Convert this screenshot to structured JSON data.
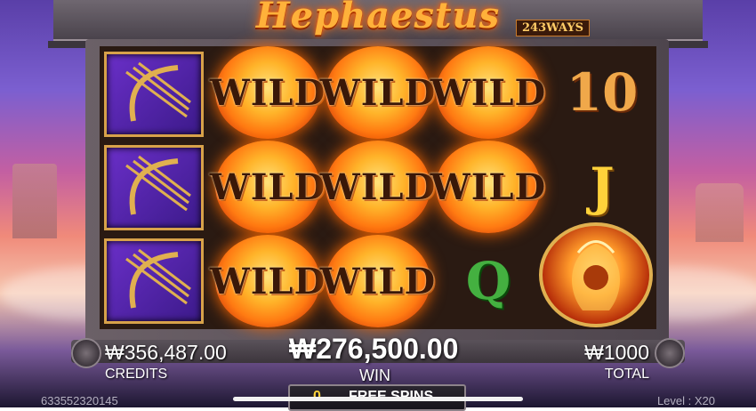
{
  "game": {
    "title": "Hephaestus",
    "ways_badge": "243WAYS"
  },
  "reels": [
    [
      "bow",
      "bow",
      "bow"
    ],
    [
      "WILD",
      "WILD",
      "WILD"
    ],
    [
      "WILD",
      "WILD",
      "WILD"
    ],
    [
      "WILD",
      "WILD",
      "Q"
    ],
    [
      "10",
      "J",
      "hephaestus-portrait"
    ]
  ],
  "symbol_labels": {
    "wild": "WILD",
    "ten": "10",
    "jack": "J",
    "queen": "Q"
  },
  "meters": {
    "credits_value": "₩356,487.00",
    "credits_label": "CREDITS",
    "win_value": "₩276,500.00",
    "win_label": "WIN",
    "total_value": "₩1000",
    "total_label": "TOTAL"
  },
  "free_spins": {
    "count": "0",
    "label": "FREE SPINS"
  },
  "footer": {
    "session_id": "633552320145",
    "level_text": "Level : X20"
  }
}
